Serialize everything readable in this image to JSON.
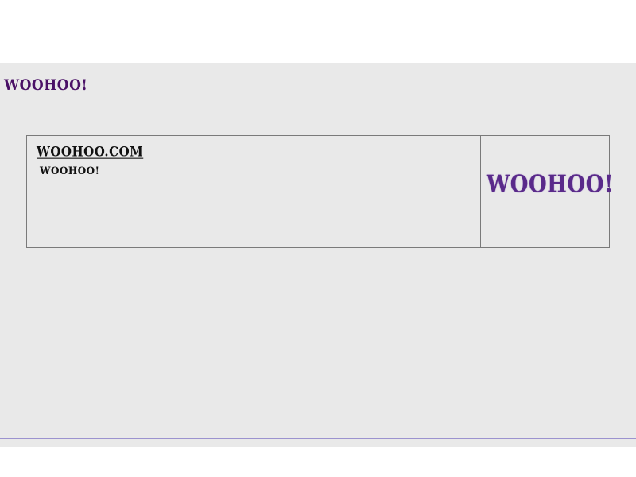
{
  "header": {
    "logo_text": "WOOHOO!"
  },
  "result": {
    "title": "WOOHOO.COM",
    "subtitle": "WOOHOO!",
    "thumbnail_text": "WOOHOO!"
  },
  "colors": {
    "brand_purple": "#4a1166",
    "panel_background": "#e9e9e9",
    "rule_line": "#9c93cf",
    "card_border": "#7a7a7a"
  }
}
